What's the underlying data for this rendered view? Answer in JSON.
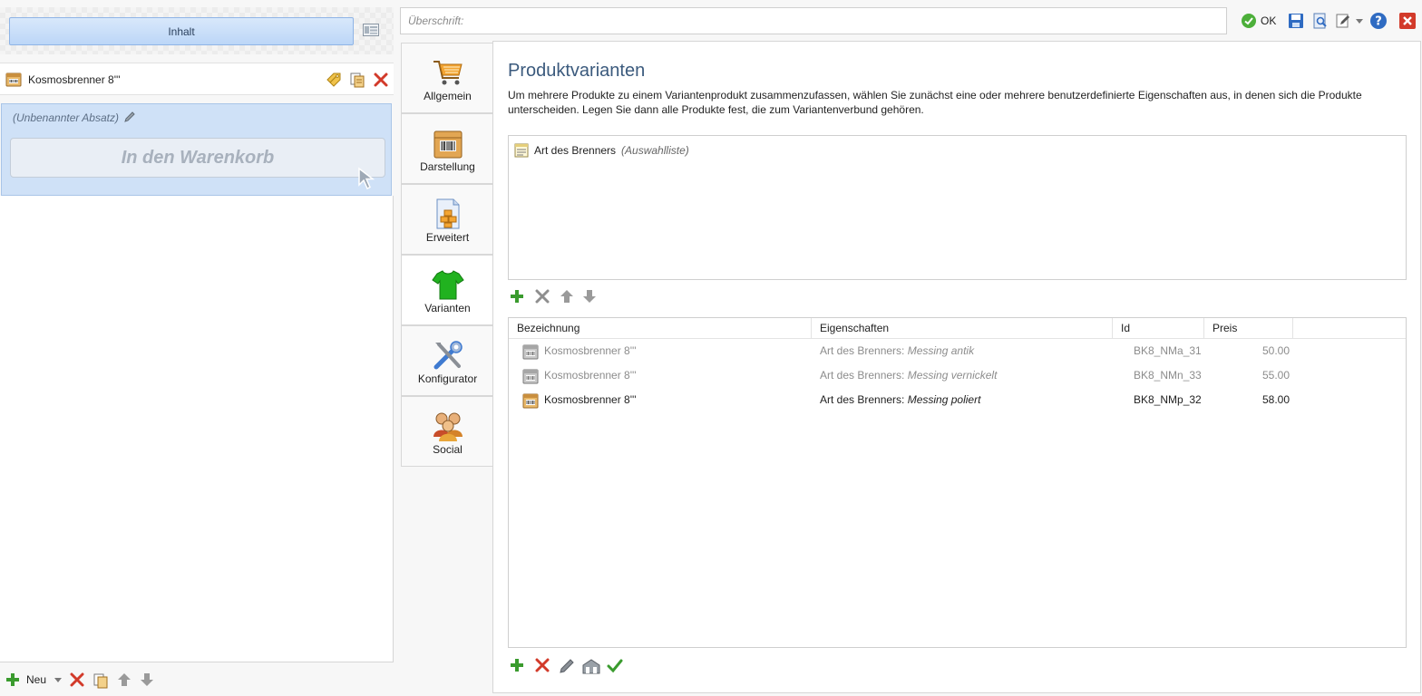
{
  "left_panel": {
    "content_button": "Inhalt",
    "product_title": "Kosmosbrenner 8'''",
    "paragraph_label": "(Unbenannter Absatz)",
    "cart_button": "In den Warenkorb",
    "bottom_toolbar": {
      "new_label": "Neu"
    }
  },
  "top_bar": {
    "heading_placeholder": "Überschrift:",
    "heading_value": "",
    "ok_label": "OK"
  },
  "tabs": [
    {
      "label": "Allgemein",
      "icon": "cart-icon"
    },
    {
      "label": "Darstellung",
      "icon": "barcode-box-icon"
    },
    {
      "label": "Erweitert",
      "icon": "document-blocks-icon"
    },
    {
      "label": "Varianten",
      "icon": "tshirt-icon",
      "active": true
    },
    {
      "label": "Konfigurator",
      "icon": "tools-icon"
    },
    {
      "label": "Social",
      "icon": "people-icon"
    }
  ],
  "main": {
    "title": "Produktvarianten",
    "description": "Um mehrere Produkte zu einem Variantenprodukt zusammenzufassen, wählen Sie zunächst eine oder mehrere benutzerdefinierte Eigenschaften aus, in denen sich die Produkte unterscheiden. Legen Sie dann alle Produkte fest, die zum Variantenverbund gehören.",
    "properties": [
      {
        "name": "Art des Brenners",
        "type": "(Auswahlliste)"
      }
    ],
    "table": {
      "columns": [
        "Bezeichnung",
        "Eigenschaften",
        "Id",
        "Preis"
      ],
      "rows": [
        {
          "name": "Kosmosbrenner 8'''",
          "prop_name": "Art des Brenners:",
          "prop_value": "Messing antik",
          "id": "BK8_NMa_31",
          "price": "50.00",
          "enabled": false
        },
        {
          "name": "Kosmosbrenner 8'''",
          "prop_name": "Art des Brenners:",
          "prop_value": "Messing vernickelt",
          "id": "BK8_NMn_33",
          "price": "55.00",
          "enabled": false
        },
        {
          "name": "Kosmosbrenner 8'''",
          "prop_name": "Art des Brenners:",
          "prop_value": "Messing poliert",
          "id": "BK8_NMp_32",
          "price": "58.00",
          "enabled": true
        }
      ]
    }
  },
  "colors": {
    "accent_blue": "#3b5a7d",
    "selection_blue": "#cfe1f7",
    "add_green": "#3a9b2e",
    "delete_red": "#d23a2a"
  }
}
